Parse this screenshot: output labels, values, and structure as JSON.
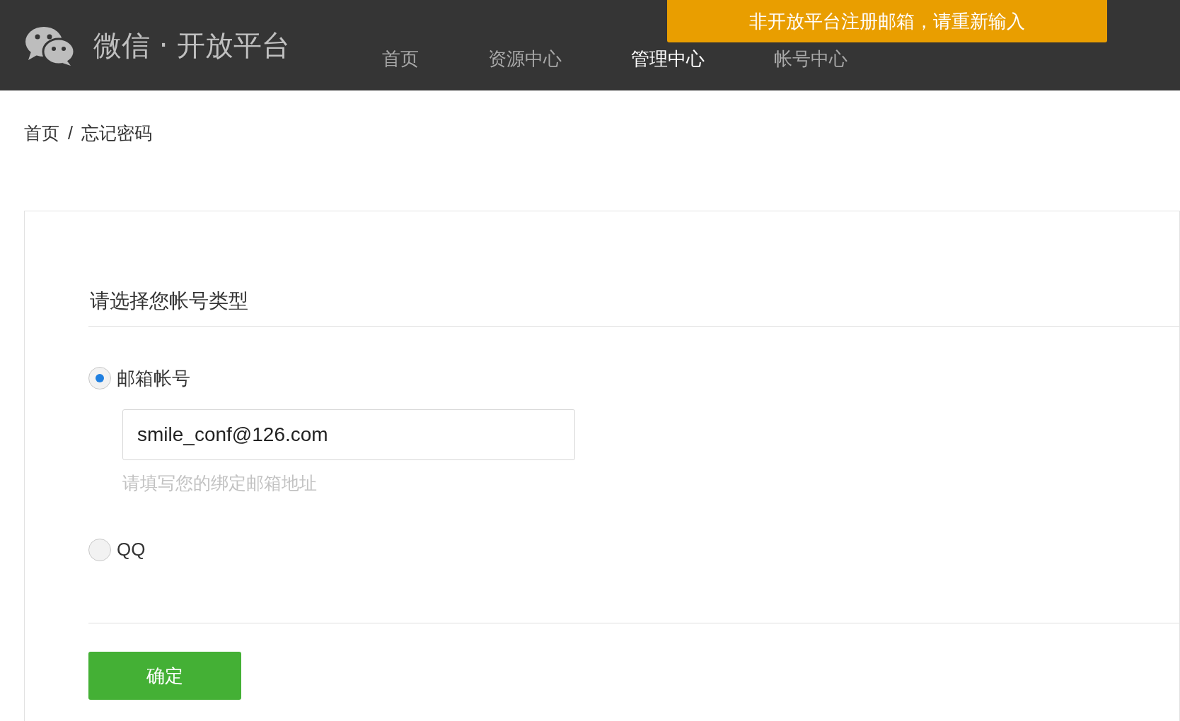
{
  "header": {
    "title": "微信 · 开放平台",
    "nav": [
      {
        "label": "首页",
        "selected": false
      },
      {
        "label": "资源中心",
        "selected": false
      },
      {
        "label": "管理中心",
        "selected": true
      },
      {
        "label": "帐号中心",
        "selected": false
      }
    ]
  },
  "toast": {
    "message": "非开放平台注册邮箱，请重新输入"
  },
  "breadcrumb": [
    "首页",
    "/",
    "忘记密码"
  ],
  "form": {
    "title": "请选择您帐号类型",
    "options": [
      {
        "label": "邮箱帐号",
        "selected": true,
        "field": {
          "value": "smile_conf@126.com",
          "hint": "请填写您的绑定邮箱地址"
        }
      },
      {
        "label": "QQ",
        "selected": false
      }
    ],
    "submit": "确定"
  }
}
